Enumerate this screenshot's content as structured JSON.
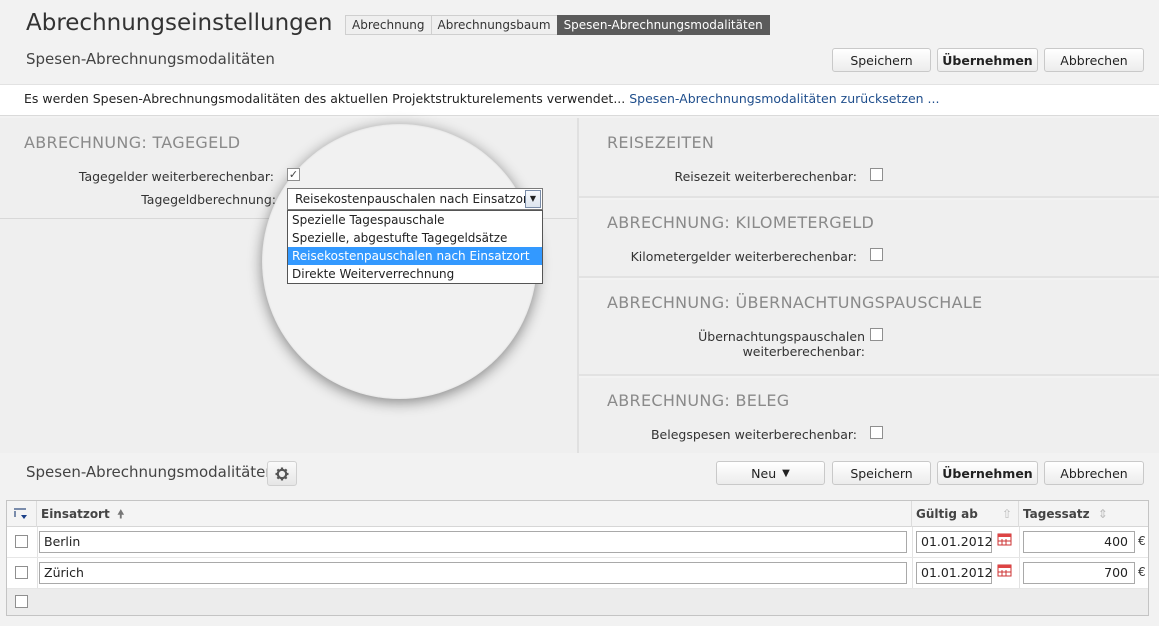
{
  "header": {
    "title": "Abrechnungseinstellungen",
    "subtitle": "Spesen-Abrechnungsmodalitäten",
    "tabs": [
      {
        "label": "Abrechnung",
        "active": false
      },
      {
        "label": "Abrechnungsbaum",
        "active": false
      },
      {
        "label": "Spesen-Abrechnungsmodalitäten",
        "active": true
      }
    ],
    "buttons": {
      "save": "Speichern",
      "apply": "Übernehmen",
      "cancel": "Abbrechen"
    }
  },
  "infobar": {
    "text": "Es werden Spesen-Abrechnungsmodalitäten des aktuellen Projektstrukturelements verwendet...",
    "link": "Spesen-Abrechnungsmodalitäten zurücksetzen ..."
  },
  "tagegeld": {
    "title": "ABRECHNUNG: TAGEGELD",
    "billable_label": "Tagegelder weiterberechenbar:",
    "billable_checked": true,
    "calc_label": "Tagegeldberechnung:",
    "calc_value": "Reisekostenpauschalen nach Einsatzort",
    "options": [
      "Spezielle Tagespauschale",
      "Spezielle, abgestufte Tagegeldsätze",
      "Reisekostenpauschalen nach Einsatzort",
      "Direkte Weiterverrechnung"
    ],
    "selected_option": "Reisekostenpauschalen nach Einsatzort"
  },
  "reisezeiten": {
    "title": "REISEZEITEN",
    "label": "Reisezeit weiterberechenbar:",
    "checked": false
  },
  "kilometergeld": {
    "title": "ABRECHNUNG: KILOMETERGELD",
    "label": "Kilometergelder weiterberechenbar:",
    "checked": false
  },
  "uebernachtung": {
    "title": "ABRECHNUNG: ÜBERNACHTUNGSPAUSCHALE",
    "label": "Übernachtungspauschalen weiterberechenbar:",
    "checked": false
  },
  "beleg": {
    "title": "ABRECHNUNG: BELEG",
    "label": "Belegspesen weiterberechenbar:",
    "checked": false
  },
  "lower": {
    "title": "Spesen-Abrechnungsmodalitäten",
    "buttons": {
      "new": "Neu",
      "save": "Speichern",
      "apply": "Übernehmen",
      "cancel": "Abbrechen"
    }
  },
  "table": {
    "columns": {
      "location": "Einsatzort",
      "valid_from": "Gültig ab",
      "rate": "Tagessatz"
    },
    "currency": "€",
    "rows": [
      {
        "location": "Berlin",
        "valid_from": "01.01.2012",
        "rate": "400"
      },
      {
        "location": "Zürich",
        "valid_from": "01.01.2012",
        "rate": "700"
      }
    ]
  },
  "colors": {
    "accent": "#3399ff",
    "active_tab": "#5b5b5b",
    "link": "#1f4e8c"
  },
  "icons": [
    "gear-icon",
    "calendar-icon",
    "sort-asc-icon",
    "dropdown-arrow-icon",
    "column-chooser-icon"
  ]
}
